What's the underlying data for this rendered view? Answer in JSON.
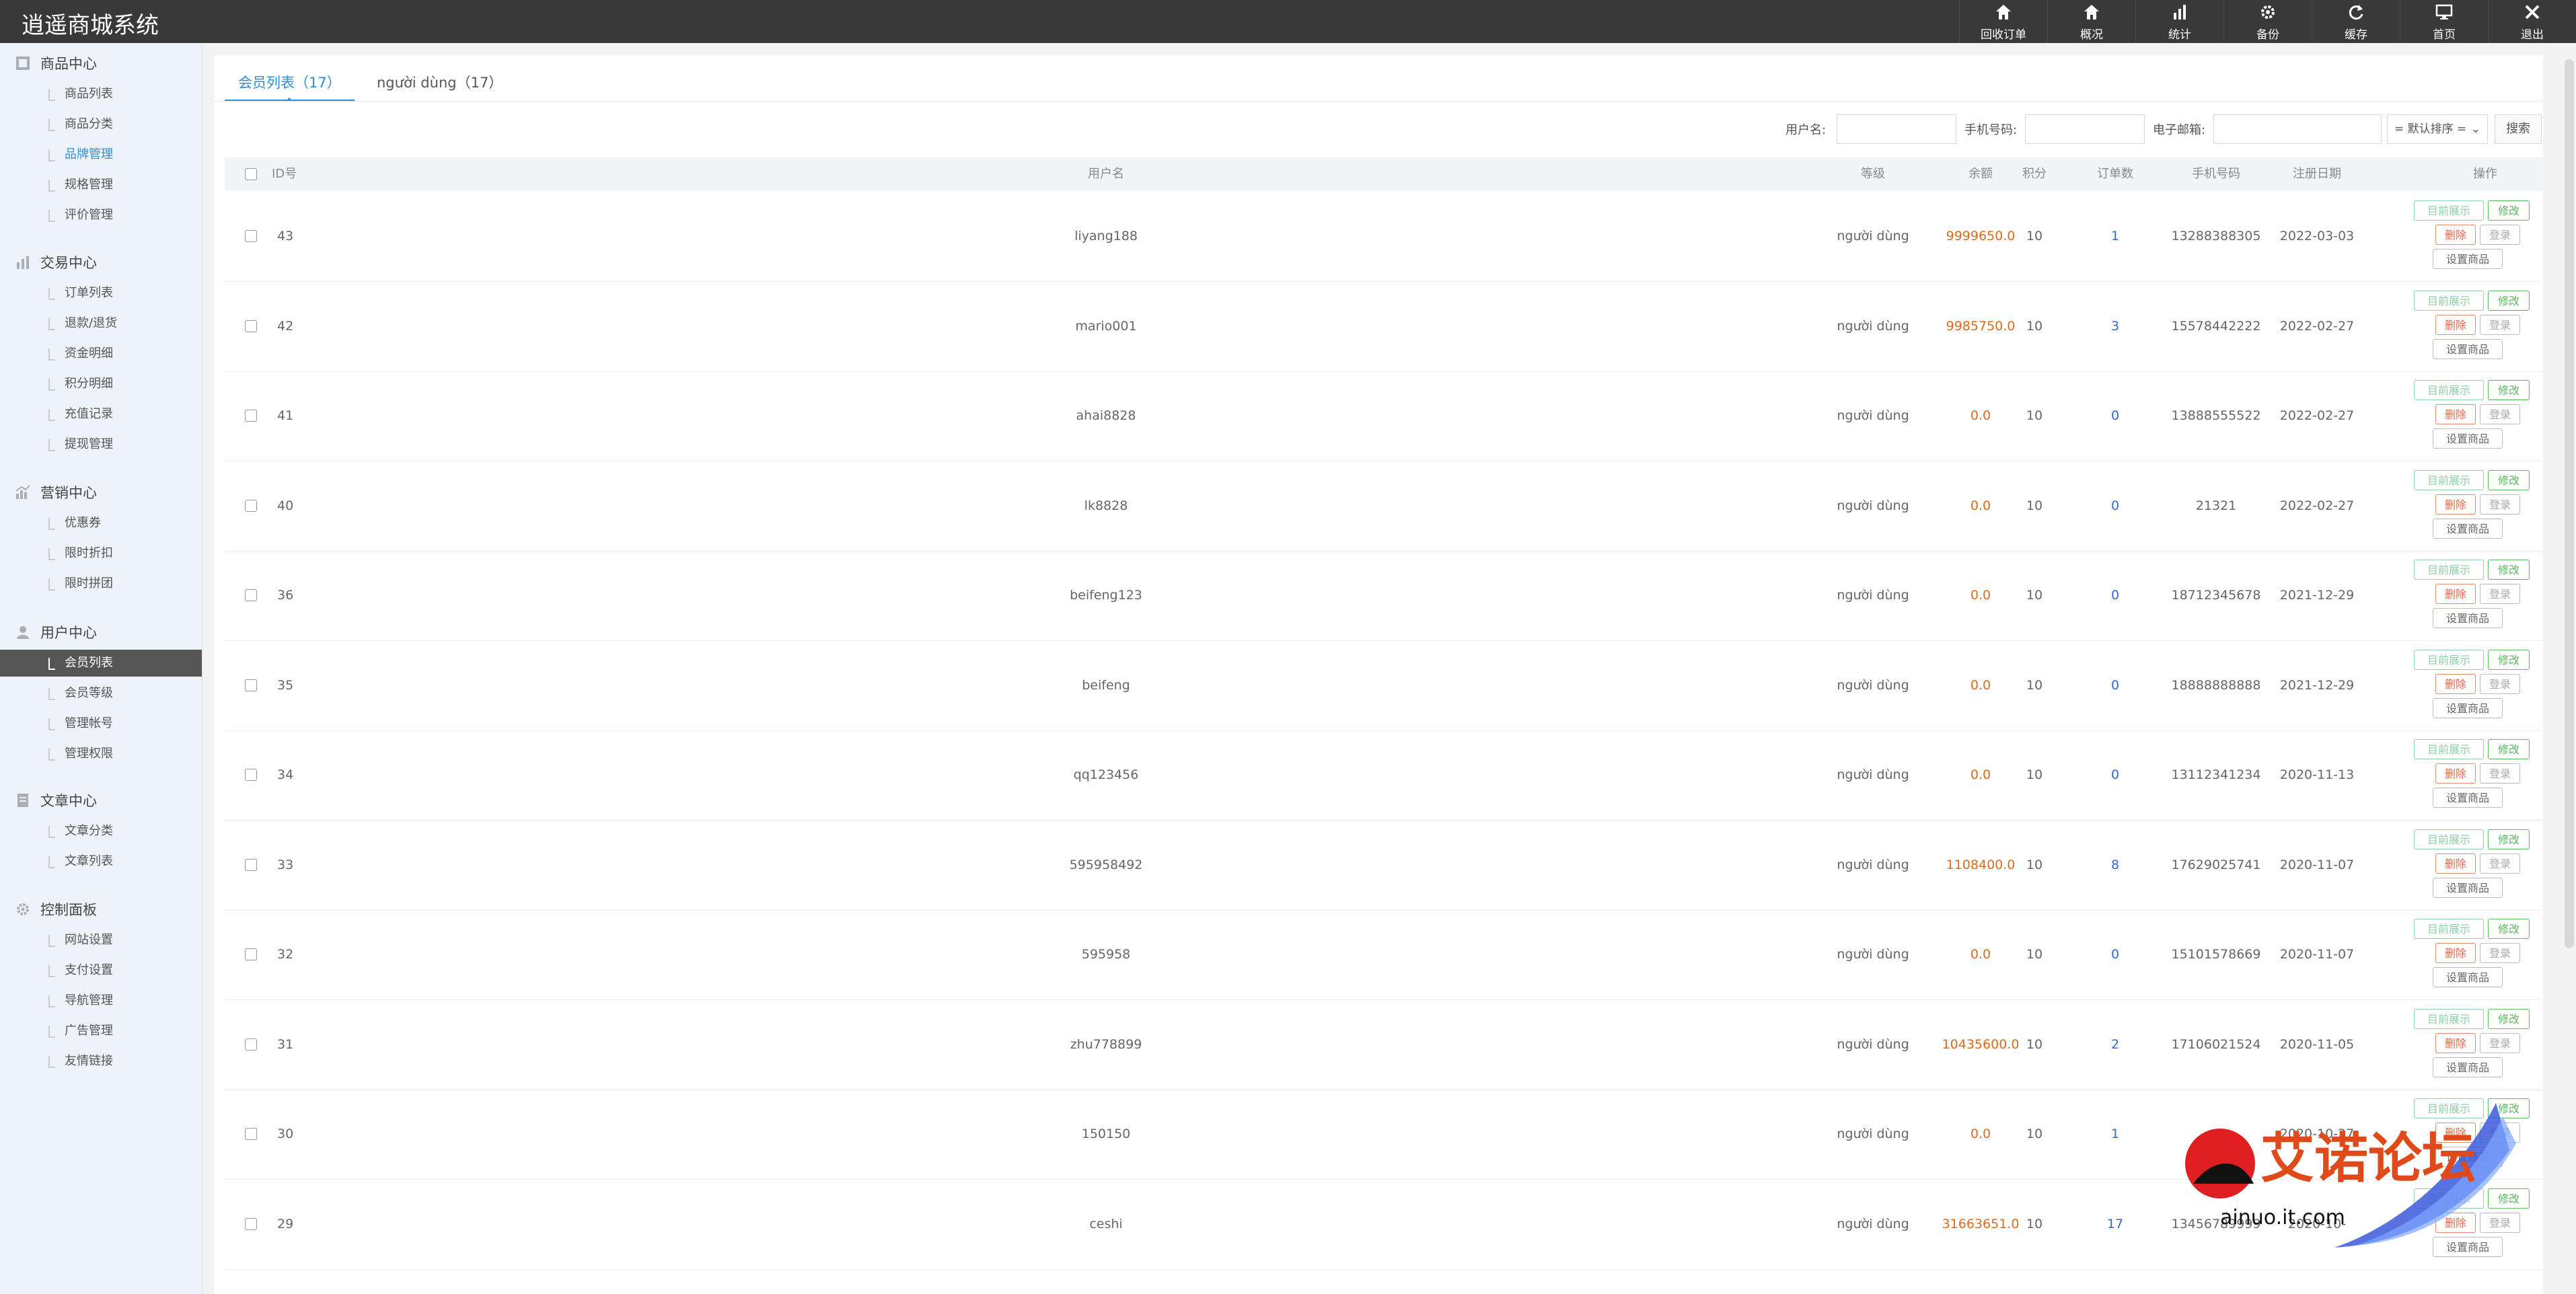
{
  "app": {
    "title": "逍遥商城系统"
  },
  "topnav": [
    {
      "label": "回收订单",
      "icon": "home-icon"
    },
    {
      "label": "概况",
      "icon": "home-icon"
    },
    {
      "label": "统计",
      "icon": "bar-chart-icon"
    },
    {
      "label": "备份",
      "icon": "gear-icon"
    },
    {
      "label": "缓存",
      "icon": "refresh-icon"
    },
    {
      "label": "首页",
      "icon": "monitor-icon"
    },
    {
      "label": "退出",
      "icon": "close-icon"
    }
  ],
  "sidebar": [
    {
      "title": "商品中心",
      "icon": "grid-icon",
      "items": [
        "商品列表",
        "商品分类",
        "品牌管理",
        "规格管理",
        "评价管理"
      ]
    },
    {
      "title": "交易中心",
      "icon": "bar-chart-icon",
      "items": [
        "订单列表",
        "退款/退货",
        "资金明细",
        "积分明细",
        "充值记录",
        "提现管理"
      ]
    },
    {
      "title": "营销中心",
      "icon": "chart-icon",
      "items": [
        "优惠券",
        "限时折扣",
        "限时拼团"
      ]
    },
    {
      "title": "用户中心",
      "icon": "user-icon",
      "items": [
        "会员列表",
        "会员等级",
        "管理帐号",
        "管理权限"
      ]
    },
    {
      "title": "文章中心",
      "icon": "document-icon",
      "items": [
        "文章分类",
        "文章列表"
      ]
    },
    {
      "title": "控制面板",
      "icon": "gear-icon",
      "items": [
        "网站设置",
        "支付设置",
        "导航管理",
        "广告管理",
        "友情链接"
      ]
    }
  ],
  "tabs": [
    {
      "label": "会员列表（17）"
    },
    {
      "label": "người dùng（17）"
    }
  ],
  "search": {
    "username_label": "用户名:",
    "phone_label": "手机号码:",
    "email_label": "电子邮箱:",
    "sort_value": "= 默认排序 =",
    "button": "搜索"
  },
  "table": {
    "headers": [
      "ID号",
      "用户名",
      "等级",
      "余额",
      "积分",
      "订单数",
      "手机号码",
      "注册日期",
      "操作"
    ],
    "actions": {
      "show": "目前展示",
      "edit": "修改",
      "delete": "删除",
      "login": "登录",
      "goods": "设置商品"
    },
    "rows": [
      {
        "id": "43",
        "name": "liyang188",
        "level": "người dùng",
        "balance": "9999650.0",
        "points": "10",
        "orders": "1",
        "phone": "13288388305",
        "date": "2022-03-03"
      },
      {
        "id": "42",
        "name": "mario001",
        "level": "người dùng",
        "balance": "9985750.0",
        "points": "10",
        "orders": "3",
        "phone": "15578442222",
        "date": "2022-02-27"
      },
      {
        "id": "41",
        "name": "ahai8828",
        "level": "người dùng",
        "balance": "0.0",
        "points": "10",
        "orders": "0",
        "phone": "13888555522",
        "date": "2022-02-27"
      },
      {
        "id": "40",
        "name": "lk8828",
        "level": "người dùng",
        "balance": "0.0",
        "points": "10",
        "orders": "0",
        "phone": "21321",
        "date": "2022-02-27"
      },
      {
        "id": "36",
        "name": "beifeng123",
        "level": "người dùng",
        "balance": "0.0",
        "points": "10",
        "orders": "0",
        "phone": "18712345678",
        "date": "2021-12-29"
      },
      {
        "id": "35",
        "name": "beifeng",
        "level": "người dùng",
        "balance": "0.0",
        "points": "10",
        "orders": "0",
        "phone": "18888888888",
        "date": "2021-12-29"
      },
      {
        "id": "34",
        "name": "qq123456",
        "level": "người dùng",
        "balance": "0.0",
        "points": "10",
        "orders": "0",
        "phone": "13112341234",
        "date": "2020-11-13"
      },
      {
        "id": "33",
        "name": "595958492",
        "level": "người dùng",
        "balance": "1108400.0",
        "points": "10",
        "orders": "8",
        "phone": "17629025741",
        "date": "2020-11-07"
      },
      {
        "id": "32",
        "name": "595958",
        "level": "người dùng",
        "balance": "0.0",
        "points": "10",
        "orders": "0",
        "phone": "15101578669",
        "date": "2020-11-07"
      },
      {
        "id": "31",
        "name": "zhu778899",
        "level": "người dùng",
        "balance": "10435600.0",
        "points": "10",
        "orders": "2",
        "phone": "17106021524",
        "date": "2020-11-05"
      },
      {
        "id": "30",
        "name": "150150",
        "level": "người dùng",
        "balance": "0.0",
        "points": "10",
        "orders": "1",
        "phone": "",
        "date": "2020-10-27"
      },
      {
        "id": "29",
        "name": "ceshi",
        "level": "người dùng",
        "balance": "31663651.0",
        "points": "10",
        "orders": "17",
        "phone": "13456789999",
        "date": "2020-10-"
      }
    ]
  },
  "watermark": {
    "text": "艾诺论坛",
    "url": "ainuo.it.com"
  },
  "colors": {
    "topbar": "#393939",
    "accent": "#2f8fd6",
    "balance": "#e06b1b",
    "orders": "#2f6bd6",
    "active_nav": "#555555"
  }
}
